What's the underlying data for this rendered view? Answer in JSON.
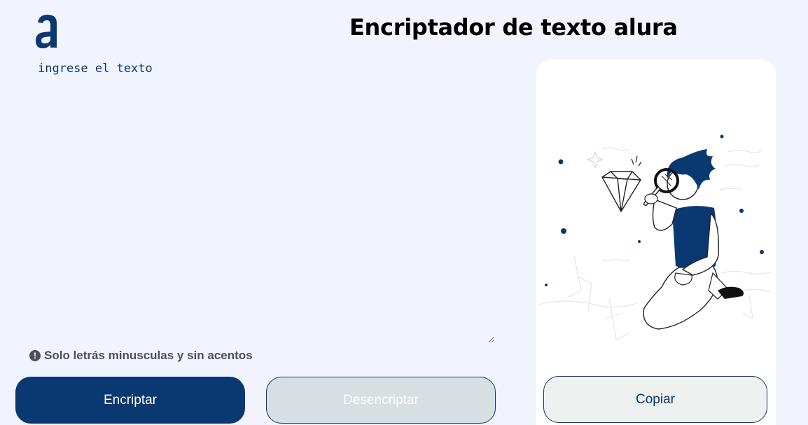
{
  "header": {
    "title": "Encriptador de texto alura"
  },
  "input": {
    "placeholder": "ingrese el texto",
    "value": ""
  },
  "hint": {
    "icon": "exclamation-circle-icon",
    "text": "Solo letrás minusculas y sin acentos"
  },
  "actions": {
    "encrypt_label": "Encriptar",
    "decrypt_label": "Desencriptar"
  },
  "output": {
    "copy_label": "Copiar"
  },
  "colors": {
    "primary": "#0a3871",
    "background": "#f1f4fc",
    "panel": "#ffffff",
    "hint": "#495057"
  }
}
